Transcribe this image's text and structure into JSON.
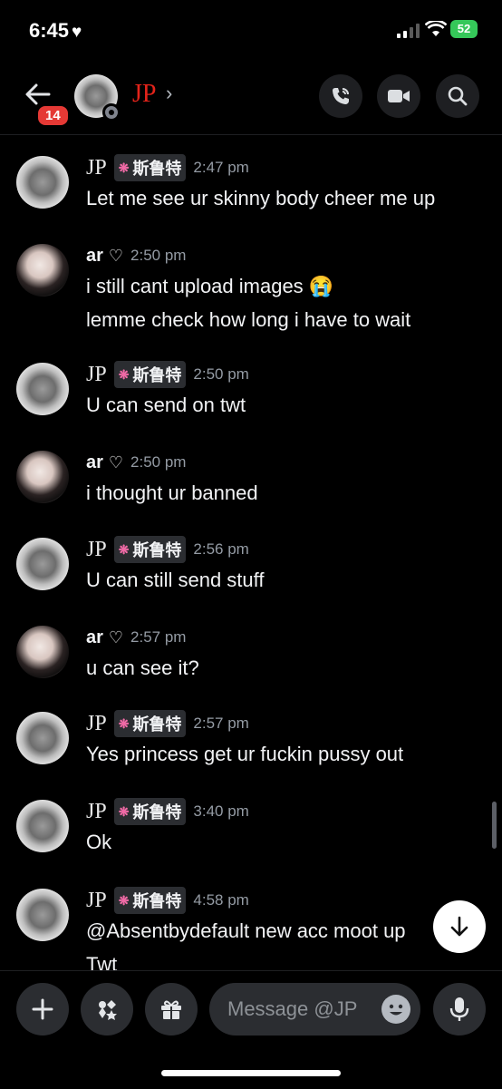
{
  "status": {
    "time": "6:45",
    "battery": "52"
  },
  "header": {
    "badge": "14",
    "name": "JP"
  },
  "server_tag": "斯鲁特",
  "messages": [
    {
      "user": "JP",
      "time": "2:47 pm",
      "lines": [
        "Let me see ur skinny body cheer me up"
      ]
    },
    {
      "user": "ar",
      "time": "2:50 pm",
      "lines": [
        "i still cant upload images 😭",
        "lemme check how long i have to wait"
      ]
    },
    {
      "user": "JP",
      "time": "2:50 pm",
      "lines": [
        "U can send on twt"
      ]
    },
    {
      "user": "ar",
      "time": "2:50 pm",
      "lines": [
        "i thought ur banned"
      ]
    },
    {
      "user": "JP",
      "time": "2:56 pm",
      "lines": [
        "U can still send stuff"
      ]
    },
    {
      "user": "ar",
      "time": "2:57 pm",
      "lines": [
        "u can see it?"
      ]
    },
    {
      "user": "JP",
      "time": "2:57 pm",
      "lines": [
        "Yes princess get ur fuckin pussy out"
      ]
    },
    {
      "user": "JP",
      "time": "3:40 pm",
      "lines": [
        "Ok"
      ]
    },
    {
      "user": "JP",
      "time": "4:58 pm",
      "lines": [
        "@Absentbydefault new acc moot up",
        "Twt"
      ]
    }
  ],
  "composer": {
    "placeholder": "Message @JP"
  }
}
